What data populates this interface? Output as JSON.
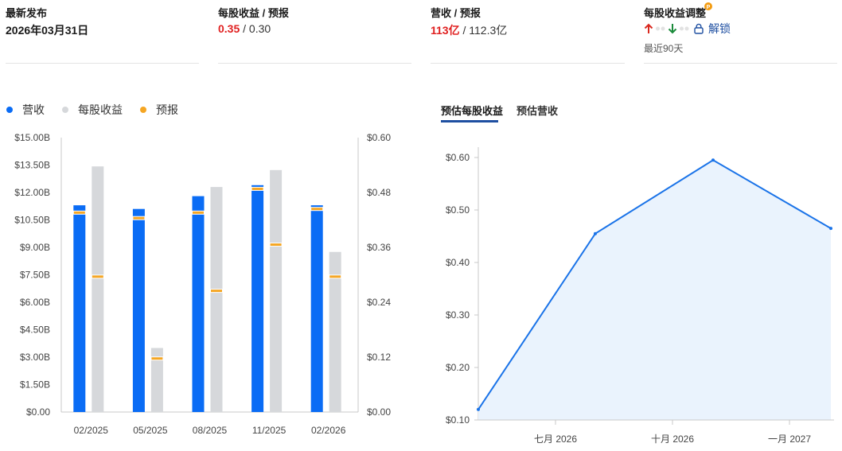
{
  "stats": {
    "latest": {
      "title": "最新发布",
      "value": "2026年03月31日"
    },
    "eps": {
      "title": "每股收益 / 预报",
      "actual": "0.35",
      "sep": " / ",
      "estimate": "0.30"
    },
    "revenue": {
      "title": "营收 / 预报",
      "actual": "113亿",
      "sep": " / ",
      "estimate": "112.3亿"
    },
    "revisions": {
      "title": "每股收益调整",
      "unlock_label": "解锁",
      "period": "最近90天",
      "badge_icon": "pro-badge-icon",
      "up_icon": "arrow-up-icon",
      "down_icon": "arrow-down-icon",
      "up_color": "#d9281e",
      "down_color": "#1a8a3a"
    }
  },
  "legend": [
    {
      "label": "营收",
      "color": "#0a6cf5"
    },
    {
      "label": "每股收益",
      "color": "#d6d8db"
    },
    {
      "label": "预报",
      "color": "#f5a623"
    }
  ],
  "tabs": [
    {
      "label": "预估每股收益",
      "active": true
    },
    {
      "label": "预估营收",
      "active": false
    }
  ],
  "colors": {
    "revenue": "#0a6cf5",
    "eps": "#d6d8db",
    "forecast": "#f5a623",
    "line": "#1a73e8",
    "area": "#eaf3fd"
  },
  "chart_data": [
    {
      "type": "bar",
      "categories": [
        "02/2025",
        "05/2025",
        "08/2025",
        "11/2025",
        "02/2026"
      ],
      "left_ticks": [
        "$0.00",
        "$1.50B",
        "$3.00B",
        "$4.50B",
        "$6.00B",
        "$7.50B",
        "$9.00B",
        "$10.50B",
        "$12.00B",
        "$13.50B",
        "$15.00B"
      ],
      "right_ticks": [
        "$0.00",
        "$0.12",
        "$0.24",
        "$0.36",
        "$0.48",
        "$0.60"
      ],
      "ylim_left": [
        0,
        15
      ],
      "ylim_right": [
        0,
        0.6
      ],
      "series": [
        {
          "name": "营收",
          "axis": "left",
          "unit": "B",
          "values": [
            11.3,
            11.1,
            11.8,
            12.4,
            11.3
          ],
          "forecast": [
            10.9,
            10.6,
            10.9,
            12.2,
            11.1
          ]
        },
        {
          "name": "每股收益",
          "axis": "right",
          "values": [
            0.537,
            0.14,
            0.492,
            0.529,
            0.35
          ],
          "forecast": [
            0.296,
            0.117,
            0.265,
            0.366,
            0.296
          ]
        }
      ]
    },
    {
      "type": "area",
      "x": [
        "2026-04",
        "2026-07",
        "2026-10",
        "2027-01"
      ],
      "x_ticks": [
        "七月 2026",
        "十月 2026",
        "一月 2027"
      ],
      "y_ticks": [
        "$0.10",
        "$0.20",
        "$0.30",
        "$0.40",
        "$0.50",
        "$0.60"
      ],
      "ylim": [
        0.1,
        0.6
      ],
      "values": [
        0.12,
        0.455,
        0.595,
        0.465
      ]
    }
  ]
}
